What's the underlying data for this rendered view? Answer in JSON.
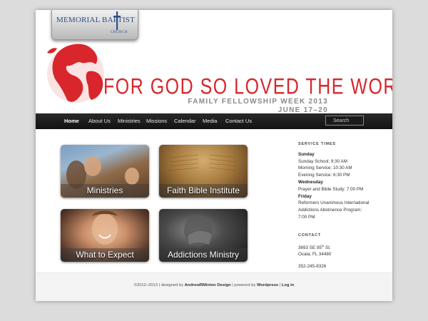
{
  "logo": {
    "line1": "MEMORIAL BAPTIST",
    "line2": "CHURCH"
  },
  "banner": {
    "headline": "FOR GOD SO LOVED THE WORLD",
    "event": "FAMILY FELLOWSHIP WEEK 2013",
    "dates": "JUNE 17–20"
  },
  "nav": {
    "items": [
      "Home",
      "About Us",
      "Ministries",
      "Missions",
      "Calendar",
      "Media",
      "Contact Us"
    ],
    "active": "Home",
    "search_placeholder": "Search"
  },
  "tiles": [
    "Ministries",
    "Faith Bible Institute",
    "What to Expect",
    "Addictions Ministry"
  ],
  "sidebar": {
    "service_heading": "SERVICE TIMES",
    "sunday": "Sunday",
    "sunday_school": "Sunday School: 9:30 AM",
    "morning_service": "Morning Service: 10:30 AM",
    "evening_service": "Evening Service: 6:30 PM",
    "wednesday": "Wednesday",
    "wed_prayer": "Prayer and Bible Study: 7:00 PM",
    "friday": "Friday",
    "fri_line1": "Reformers Unanimous International",
    "fri_line2": "Addictions Abstinence Program:",
    "fri_time": "7:00 PM",
    "contact_heading": "CONTACT",
    "address1_pre": "3693 SE 95",
    "address1_sup": "th",
    "address1_post": " St.",
    "address2": "Ocala, FL 34480",
    "phone": "352-245-8326"
  },
  "footer": {
    "copyright": "©2012–2013 | designed by ",
    "designer": "AndrewRMinion Design",
    "powered": " | powered by ",
    "platform": "Wordpress",
    "sep": " | ",
    "login": "Log in"
  },
  "colors": {
    "accent_red": "#d8262c",
    "nav_bg": "#1a1a1a",
    "logo_blue": "#2f4f86"
  }
}
